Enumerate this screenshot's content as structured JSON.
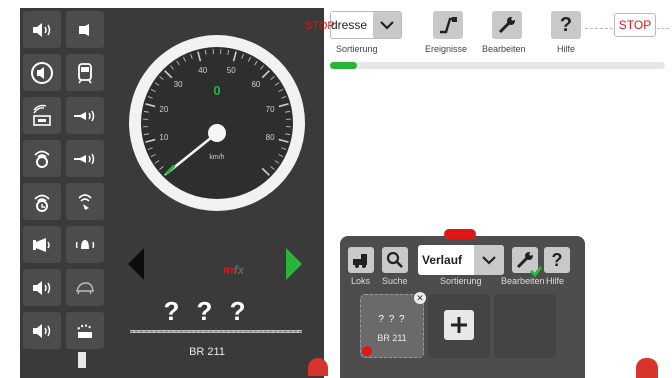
{
  "toolbar": {
    "sort_value": "dresse",
    "sort_label": "Sortierung",
    "events_label": "Ereignisse",
    "edit_label": "Bearbeiten",
    "help_label": "Hilfe",
    "help_symbol": "?",
    "stop_label": "STOP"
  },
  "progress": {
    "fraction": 0.08,
    "color": "#27b53a"
  },
  "control": {
    "stop_label": "STOP",
    "speed_value": "0",
    "unit": "km/h",
    "ticks": [
      "10",
      "20",
      "30",
      "40",
      "50",
      "60",
      "70",
      "80"
    ],
    "protocol_prefix": "m",
    "protocol_suffix": "fx",
    "address": "? ? ?",
    "name": "BR 211"
  },
  "functions": {
    "left": [
      "sound-icon",
      "lamp-icon",
      "station-sound-icon",
      "radio-sound-icon",
      "radio-sound-icon",
      "sound-icon",
      "sound-icon",
      "sound-icon"
    ],
    "right": [
      "light-icon",
      "coach-icon",
      "horn-icon",
      "horn-icon",
      "signal-icon",
      "bell-icon",
      "turtle-icon",
      "shunting-icon"
    ]
  },
  "loco_list": {
    "locos_label": "Loks",
    "search_label": "Suche",
    "sort_value": "Verlauf",
    "sort_label": "Sortierung",
    "edit_label": "Bearbeiten",
    "help_label": "Hilfe",
    "help_symbol": "?",
    "card_address": "? ? ?",
    "card_name": "BR 211",
    "add_symbol": "+",
    "close_symbol": "✕"
  },
  "colors": {
    "stop": "#e01515",
    "accent_green": "#27b53a",
    "panel": "#3a3a3a"
  }
}
